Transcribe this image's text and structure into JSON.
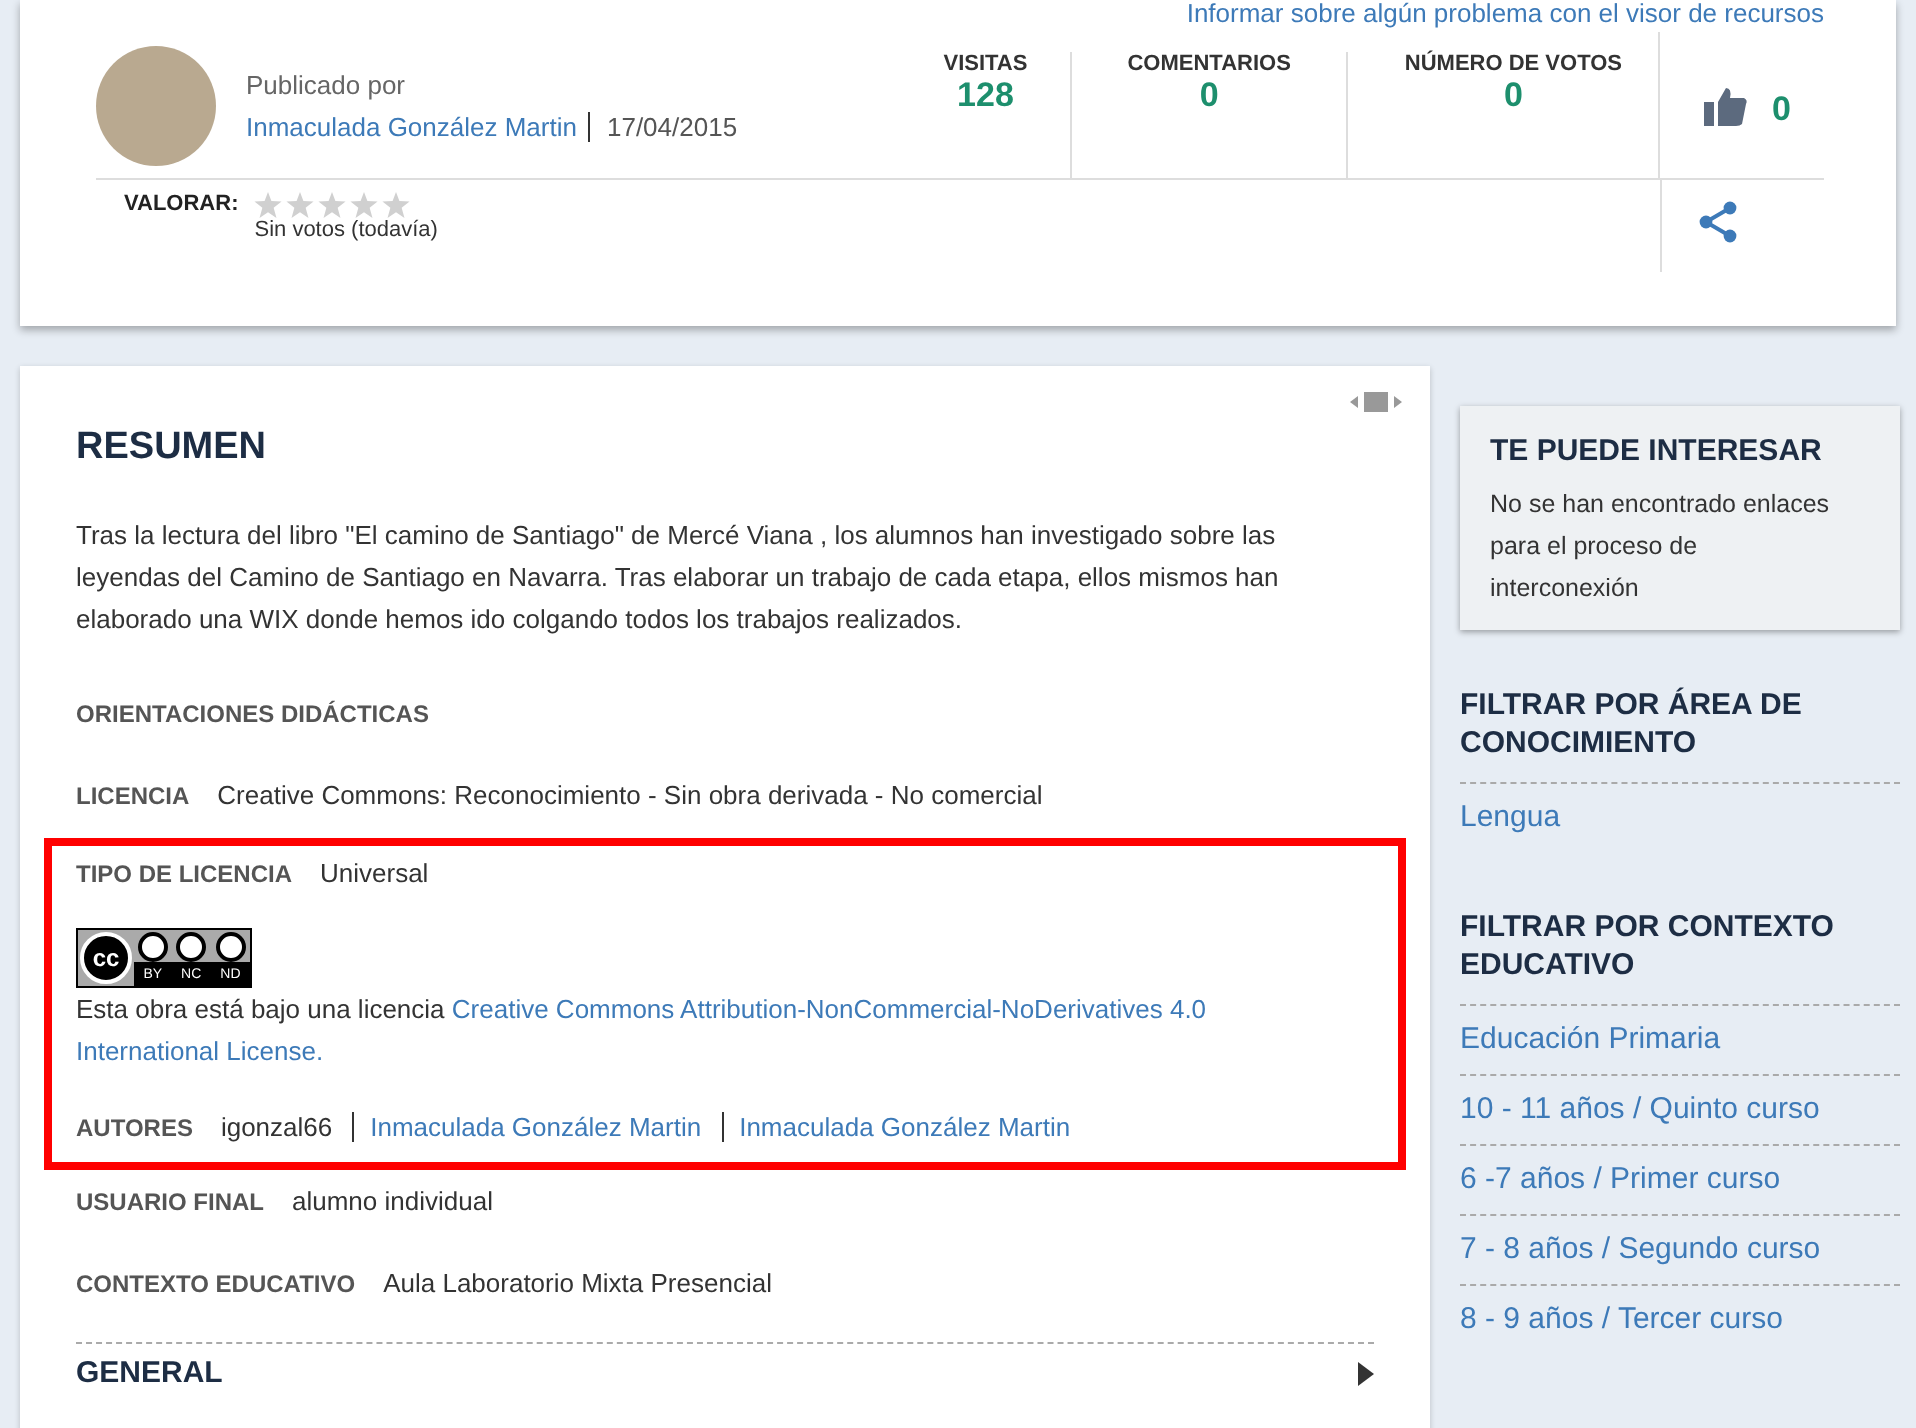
{
  "report_link": "Informar sobre algún problema con el visor de recursos",
  "publisher": {
    "label": "Publicado por",
    "name": "Inmaculada González Martin",
    "date": "17/04/2015"
  },
  "stats": [
    {
      "label": "VISITAS",
      "value": "128"
    },
    {
      "label": "COMENTARIOS",
      "value": "0"
    },
    {
      "label": "NÚMERO DE VOTOS",
      "value": "0"
    }
  ],
  "likes": "0",
  "rating": {
    "label": "VALORAR:",
    "stars": 0,
    "note": "Sin votos (todavía)"
  },
  "summary": {
    "title": "RESUMEN",
    "text": "Tras la lectura del libro \"El camino de Santiago\" de Mercé Viana , los alumnos han investigado sobre las leyendas del Camino de Santiago en Navarra. Tras elaborar un trabajo de cada etapa, ellos mismos han elaborado una WIX donde hemos ido colgando todos los trabajos realizados."
  },
  "fields_before": [
    {
      "kind": "heading",
      "label": "ORIENTACIONES DIDÁCTICAS"
    },
    {
      "kind": "text",
      "label": "LICENCIA",
      "value": "Creative Commons: Reconocimiento - Sin obra derivada - No comercial"
    }
  ],
  "license_box": {
    "label": "TIPO DE LICENCIA",
    "value": "Universal",
    "badge": {
      "mark": "cc",
      "terms": [
        "BY",
        "NC",
        "ND"
      ]
    },
    "note": "Esta obra está bajo una licencia ",
    "note_link_lines": [
      "Creative Commons Attribution-NonCommercial-NoDerivatives 4.0",
      "International License."
    ],
    "authors_label": "AUTORES",
    "authors": [
      {
        "kind": "text",
        "name": "igonzal66"
      },
      {
        "kind": "link",
        "name": "Inmaculada González Martin"
      },
      {
        "kind": "link",
        "name": "Inmaculada González Martin"
      }
    ]
  },
  "fields_after": [
    {
      "kind": "text",
      "label": "USUARIO FINAL",
      "value": "alumno individual"
    },
    {
      "kind": "text",
      "label": "CONTEXTO EDUCATIVO",
      "value": "Aula Laboratorio Mixta Presencial"
    }
  ],
  "general": "GENERAL",
  "sidebar": {
    "interest": {
      "title": "TE PUEDE INTERESAR",
      "text": "No se han encontrado enlaces para el proceso de interconexión"
    },
    "filters": [
      {
        "title": "FILTRAR POR ÁREA DE CONOCIMIENTO",
        "items": [
          "Lengua"
        ]
      },
      {
        "title": "FILTRAR POR CONTEXTO EDUCATIVO",
        "items": [
          "Educación Primaria",
          "10 - 11 años / Quinto curso",
          "6 -7 años / Primer curso",
          "7 - 8 años / Segundo curso",
          "8 - 9 años / Tercer curso"
        ]
      }
    ]
  }
}
